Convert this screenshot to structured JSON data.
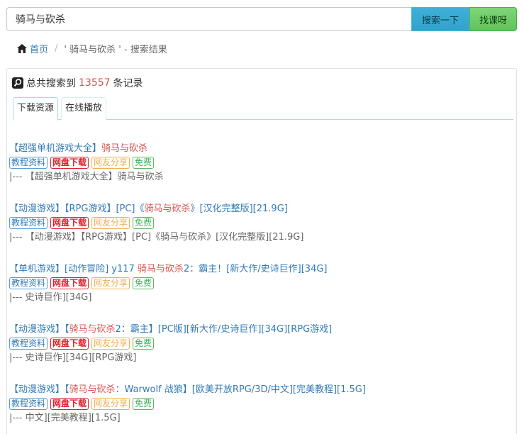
{
  "search": {
    "value": "骑马与砍杀",
    "search_button": "搜索一下",
    "find_button": "找课呀"
  },
  "breadcrumb": {
    "home": "首页",
    "separator": "/",
    "current": "' 骑马与砍杀 ' - 搜索结果"
  },
  "summary": {
    "prefix": "总共搜索到",
    "count": "13557",
    "suffix": "条记录"
  },
  "tabs": [
    "下载资源",
    "在线播放"
  ],
  "badges": {
    "tutorial": "教程资料",
    "netdisk": "网盘下载",
    "share": "网友分享",
    "free": "免费"
  },
  "results": [
    {
      "title_pre": "【超强单机游戏大全】",
      "title_hl": "骑马与砍杀",
      "title_post": "",
      "desc": "|--- 【超强单机游戏大全】骑马与砍杀"
    },
    {
      "title_pre": "【动漫游戏】【RPG游戏】[PC]《",
      "title_hl": "骑马与砍杀",
      "title_post": "》[汉化完整版][21.9G]",
      "desc": "|--- 【动漫游戏】【RPG游戏】[PC]《骑马与砍杀》[汉化完整版][21.9G]"
    },
    {
      "title_pre": "【单机游戏】[动作冒险] y117 ",
      "title_hl": "骑马与砍杀",
      "title_post": "2：霸主！[新大作/史诗巨作][34G]",
      "desc": "|--- 史诗巨作][34G]"
    },
    {
      "title_pre": "【动漫游戏】【",
      "title_hl": "骑马与砍杀",
      "title_post": "2：霸主】[PC版][新大作/史诗巨作][34G][RPG游戏]",
      "desc": "|--- 史诗巨作][34G][RPG游戏]"
    },
    {
      "title_pre": "【动漫游戏】【",
      "title_hl": "骑马与砍杀",
      "title_post": "：Warwolf 战狼】[欧美开放RPG/3D/中文][完美教程][1.5G]",
      "desc": "|--- 中文][完美教程][1.5G]"
    }
  ],
  "colors": {
    "link": "#337ab7",
    "highlight": "#d9534f",
    "search_button": "#2ea3cc",
    "find_button": "#5ec45a"
  }
}
